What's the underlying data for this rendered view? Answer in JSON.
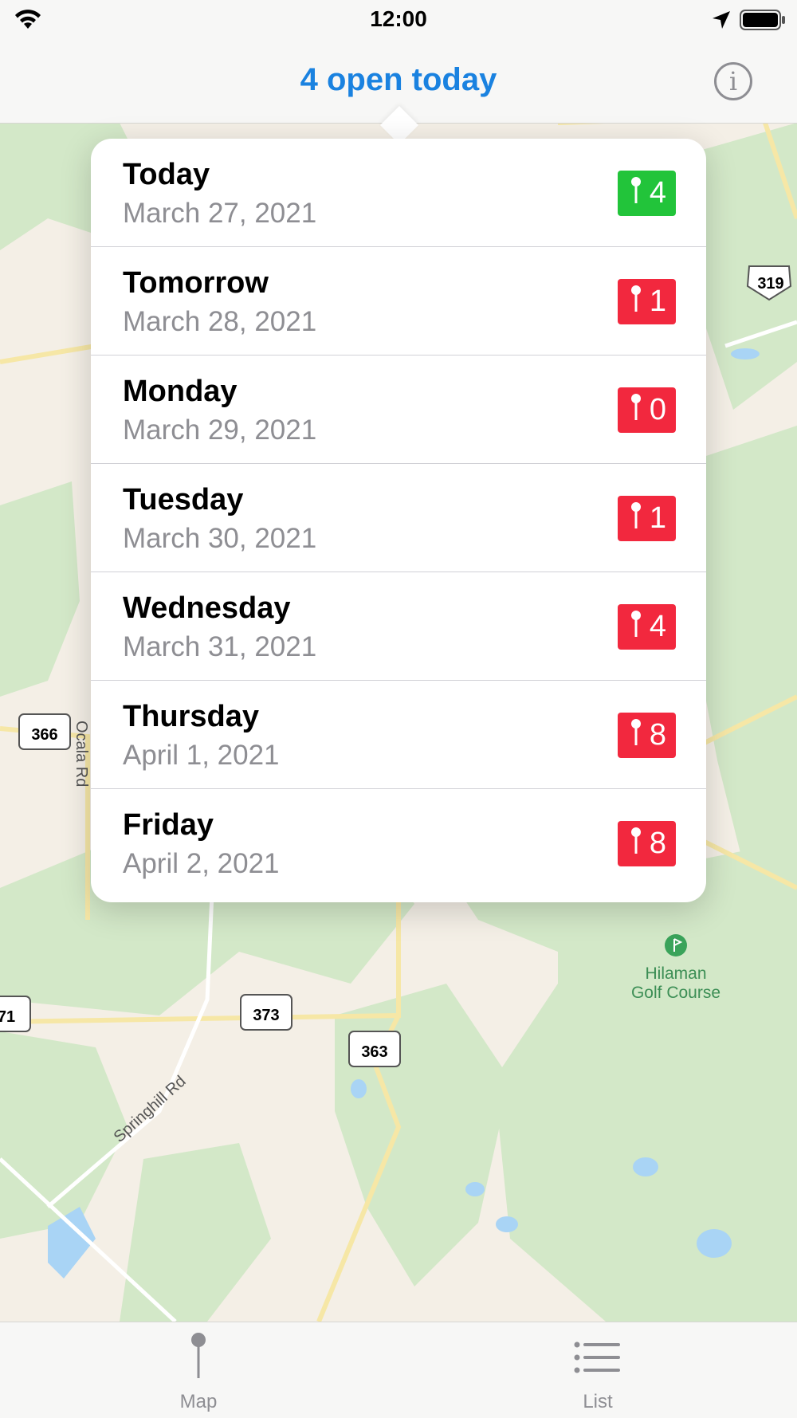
{
  "status_bar": {
    "time": "12:00"
  },
  "nav": {
    "title": "4 open today",
    "info_icon": "info-icon"
  },
  "map": {
    "labels": {
      "ocala_rd": "Ocala Rd",
      "springhill_rd": "Springhill Rd",
      "golf_line1": "Hilaman",
      "golf_line2": "Golf Course"
    },
    "shields": {
      "us_319": "319",
      "fl_366": "366",
      "fl_373": "373",
      "fl_363": "363",
      "fl_71": "71"
    }
  },
  "popover": {
    "rows": [
      {
        "day": "Today",
        "date": "March 27, 2021",
        "count": "4",
        "status": "green"
      },
      {
        "day": "Tomorrow",
        "date": "March 28, 2021",
        "count": "1",
        "status": "red"
      },
      {
        "day": "Monday",
        "date": "March 29, 2021",
        "count": "0",
        "status": "red"
      },
      {
        "day": "Tuesday",
        "date": "March 30, 2021",
        "count": "1",
        "status": "red"
      },
      {
        "day": "Wednesday",
        "date": "March 31, 2021",
        "count": "4",
        "status": "red"
      },
      {
        "day": "Thursday",
        "date": "April 1, 2021",
        "count": "8",
        "status": "red"
      },
      {
        "day": "Friday",
        "date": "April 2, 2021",
        "count": "8",
        "status": "red"
      }
    ]
  },
  "tabbar": {
    "map_label": "Map",
    "list_label": "List"
  },
  "colors": {
    "accent": "#1a82e0",
    "open_badge": "#22c43a",
    "closed_badge": "#f2283e"
  }
}
